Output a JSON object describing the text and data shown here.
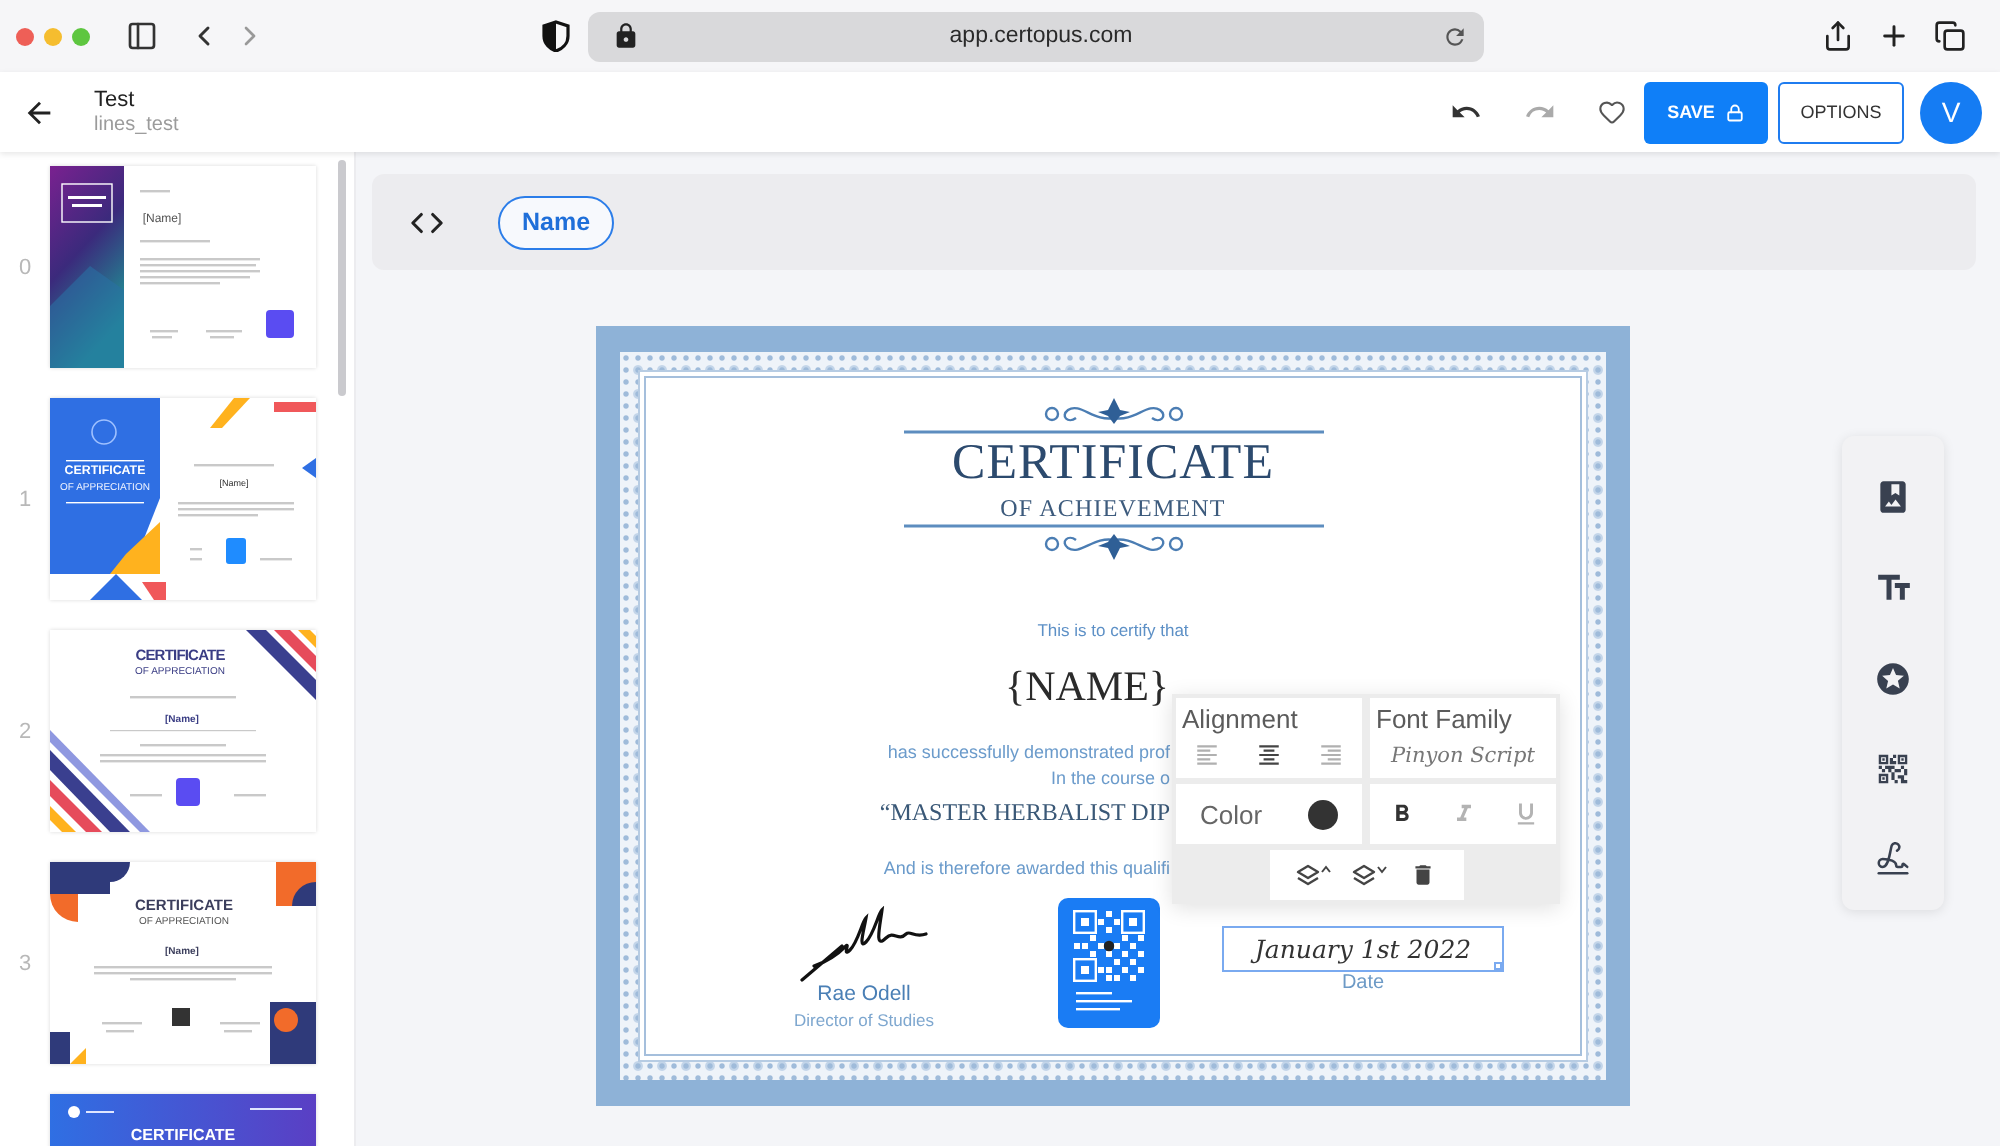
{
  "browser": {
    "url": "app.certopus.com"
  },
  "header": {
    "title": "Test",
    "subtitle": "lines_test",
    "undo": {
      "disabled": false
    },
    "redo": {
      "disabled": true
    },
    "favorite": false,
    "save": {
      "label": "SAVE"
    },
    "options": {
      "label": "OPTIONS"
    },
    "avatar": {
      "initial": "V"
    }
  },
  "templates": [
    {
      "index": "0",
      "kind": "purple",
      "selected": false,
      "name": "[Name]"
    },
    {
      "index": "1",
      "kind": "panel",
      "selected": false,
      "title": "CERTIFICATE",
      "subtitle": "OF APPRECIATION",
      "name": "[Name]"
    },
    {
      "index": "2",
      "kind": "stripes",
      "selected": false,
      "title": "CERTIFICATE",
      "subtitle": "OF APPRECIATION",
      "name": "[Name]"
    },
    {
      "index": "3",
      "kind": "geometric",
      "selected": false,
      "title": "CERTIFICATE",
      "subtitle": "OF APPRECIATION",
      "name": "[Name]"
    },
    {
      "kind": "banner",
      "selected": false,
      "title": "CERTIFICATE"
    }
  ],
  "field_bar": {
    "fields": [
      {
        "label": "Name"
      }
    ]
  },
  "certificate": {
    "title": "CERTIFICATE",
    "subtitle": "OF ACHIEVEMENT",
    "intro": "This is to certify that",
    "recipient": "{NAME}",
    "body": [
      {
        "kind": "plain",
        "text": "has successfully demonstrated prof"
      },
      {
        "kind": "plain",
        "text": "In the course o"
      },
      {
        "kind": "course",
        "text": "“MASTER HERBALIST DIP"
      },
      {
        "kind": "plain",
        "text": "And is therefore awarded this qualifi"
      }
    ],
    "signatory": {
      "name": "Rae Odell",
      "role": "Director of Studies"
    },
    "date": {
      "value": "January 1st 2022",
      "label": "Date",
      "selected": true
    }
  },
  "format_menu": {
    "alignment_label": "Alignment",
    "alignment_options": [
      {
        "selected": false
      },
      {
        "selected": true
      },
      {
        "selected": false
      }
    ],
    "font_family_label": "Font Family",
    "font_family": "Pinyon Script",
    "color_label": "Color",
    "color": "#333333",
    "bold": true,
    "italic": false,
    "underline": false
  }
}
